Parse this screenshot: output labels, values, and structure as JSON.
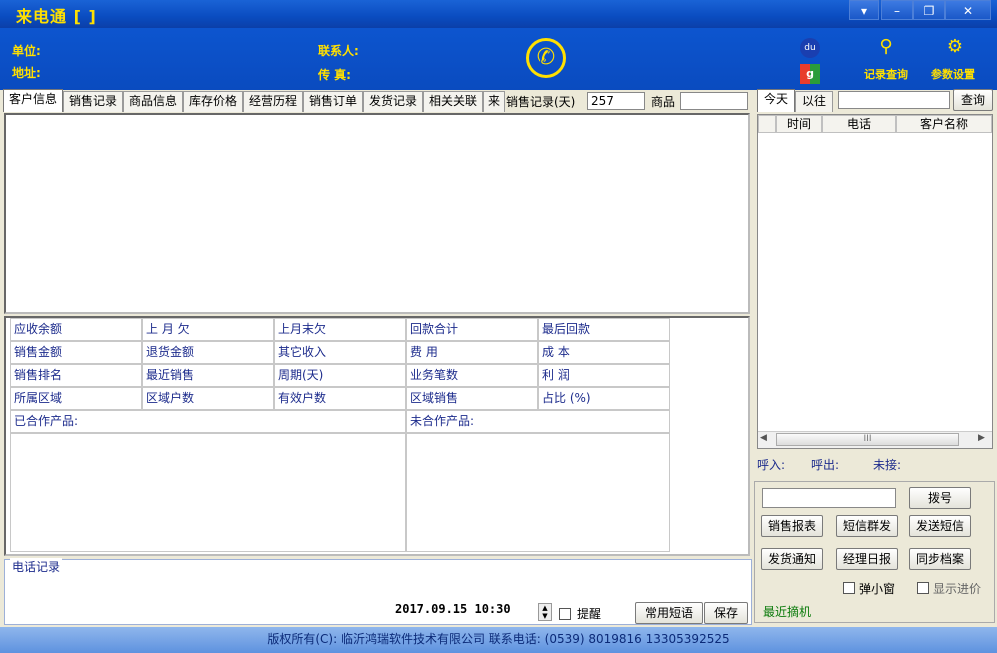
{
  "title": "来电通 [  ]",
  "window_controls": [
    "▾",
    "–",
    "❐",
    "✕"
  ],
  "header": {
    "unit_label": "单位:",
    "address_label": "地址:",
    "contact_label": "联系人:",
    "fax_label": "传  真:",
    "record_query": "记录查询",
    "param_settings": "参数设置"
  },
  "tabs": [
    "客户信息",
    "销售记录",
    "商品信息",
    "库存价格",
    "经营历程",
    "销售订单",
    "发货记录",
    "相关关联",
    "来"
  ],
  "sales_days_label": "销售记录(天)",
  "sales_days_value": "257",
  "goods_label": "商品",
  "goods_value": "",
  "stats": {
    "row1": [
      "应收余额",
      "上 月 欠",
      "上月末欠",
      "回款合计",
      "最后回款"
    ],
    "row2": [
      "销售金额",
      "退货金额",
      "其它收入",
      "费    用",
      "成    本"
    ],
    "row3": [
      "销售排名",
      "最近销售",
      "周期(天)",
      "业务笔数",
      "利    润"
    ],
    "row4": [
      "所属区域",
      "区域户数",
      "有效户数",
      "区域销售",
      "占比 (%)"
    ],
    "cooperated": "已合作产品:",
    "not_cooperated": "未合作产品:"
  },
  "phone_log": {
    "label": "电话记录",
    "datetime": "2017.09.15  10:30",
    "remind_label": "提醒",
    "common_phrases": "常用短语",
    "save": "保存"
  },
  "right": {
    "tab_today": "今天",
    "tab_before": "以往",
    "search_value": "",
    "query_btn": "查询",
    "columns": [
      "时间",
      "电话",
      "客户名称"
    ],
    "scroll_mid": "III",
    "incoming": "呼入:",
    "outgoing": "呼出:",
    "missed": "未接:",
    "dial_input": "",
    "dial": "拨号",
    "sales_report": "销售报表",
    "sms_group": "短信群发",
    "send_sms": "发送短信",
    "ship_notice": "发货通知",
    "manager_daily": "经理日报",
    "sync_archive": "同步档案",
    "popup_small": "弹小窗",
    "show_cost": "显示进价",
    "recent_pick": "最近摘机"
  },
  "statusbar": {
    "copyright": "版权所有(C): 临沂鸿瑞软件技术有限公司   联系电话: (0539) 8019816  13305392525"
  },
  "colors": {
    "title_bar": "#0a4cc0",
    "accent_yellow": "#ffe000",
    "label_blue": "#1c2b8c"
  }
}
